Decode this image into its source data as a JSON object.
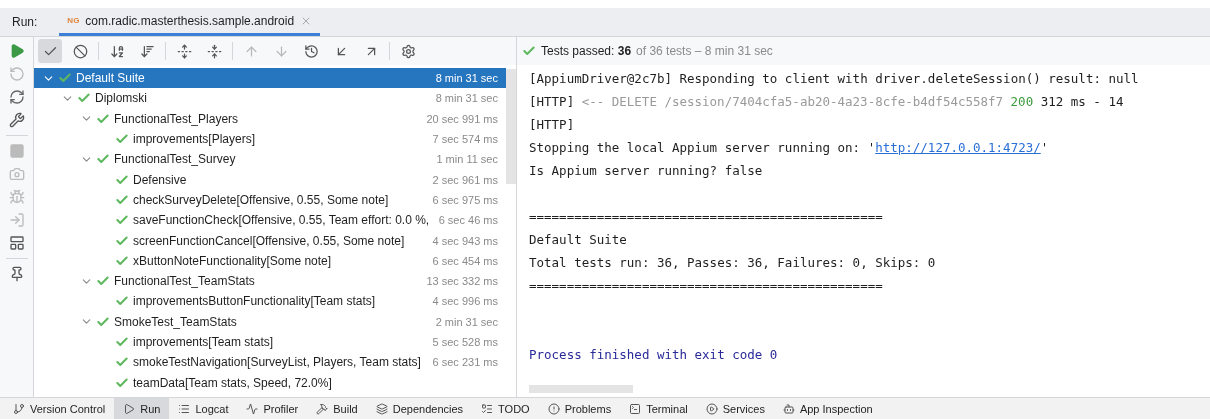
{
  "run_header": {
    "label": "Run:",
    "tab": {
      "badge": "NG",
      "title": "com.radic.masterthesis.sample.android",
      "selected": true
    }
  },
  "status": {
    "passed": "Tests passed: **36**",
    "detail": "of 36 tests – 8 min 31 sec"
  },
  "tree": [
    {
      "name": "Default Suite",
      "time": "8 min 31 sec",
      "selected": true,
      "expanded": true,
      "children": [
        {
          "name": "Diplomski",
          "time": "8 min 31 sec",
          "selected": false,
          "expanded": true,
          "children": [
            {
              "name": "FunctionalTest_Players",
              "time": "20 sec 991 ms",
              "selected": false,
              "expanded": true,
              "children": [
                {
                  "name": "improvements[Players]",
                  "time": "7 sec 574 ms",
                  "selected": false
                }
              ]
            },
            {
              "name": "FunctionalTest_Survey",
              "time": "1 min 11 sec",
              "selected": false,
              "expanded": true,
              "children": [
                {
                  "name": "Defensive",
                  "time": "2 sec 961 ms",
                  "selected": false
                },
                {
                  "name": "checkSurveyDelete[Offensive, 0.55, Some note]",
                  "time": "6 sec 975 ms",
                  "selected": false
                },
                {
                  "name": "saveFunctionCheck[Offensive, 0.55, Team effort: 0.0 %,",
                  "time": "6 sec 46 ms",
                  "selected": false
                },
                {
                  "name": "screenFunctionCancel[Offensive, 0.55, Some note]",
                  "time": "4 sec 943 ms",
                  "selected": false
                },
                {
                  "name": "xButtonNoteFunctionality[Some note]",
                  "time": "6 sec 454 ms",
                  "selected": false
                }
              ]
            },
            {
              "name": "FunctionalTest_TeamStats",
              "time": "13 sec 332 ms",
              "selected": false,
              "expanded": true,
              "children": [
                {
                  "name": "improvementsButtonFunctionality[Team stats]",
                  "time": "4 sec 996 ms",
                  "selected": false
                }
              ]
            },
            {
              "name": "SmokeTest_TeamStats",
              "time": "2 min 31 sec",
              "selected": false,
              "expanded": true,
              "children": [
                {
                  "name": "improvements[Team stats]",
                  "time": "5 sec 528 ms",
                  "selected": false
                },
                {
                  "name": "smokeTestNavigation[SurveyList, Players, Team stats]",
                  "time": "6 sec 231 ms",
                  "selected": false
                },
                {
                  "name": "teamData[Team stats, Speed, 72.0%]",
                  "selected": false
                }
              ]
            }
          ]
        }
      ]
    }
  ],
  "console": [
    {
      "kind": "text",
      "segments": [
        {
          "kind": "plain",
          "text": "[AppiumDriver@2c7b] Responding to client with driver.deleteSession() result: null"
        }
      ]
    },
    {
      "kind": "text",
      "segments": [
        {
          "kind": "plain",
          "text": "[HTTP]"
        },
        {
          "kind": "muted",
          "text": "<-- DELETE /session/7404cfa5-ab20-4a23-8cfe-b4df54c558f7"
        },
        {
          "kind": "success",
          "text": "200"
        },
        {
          "kind": "plain",
          "text": "312 ms - 14"
        }
      ]
    },
    {
      "kind": "text",
      "segments": [
        {
          "kind": "plain",
          "text": "[HTTP]"
        }
      ]
    },
    {
      "kind": "text",
      "segments": [
        {
          "kind": "plain",
          "text": "Stopping the local Appium server running on: '"
        },
        {
          "kind": "link",
          "text": "http://127.0.0.1:4723/",
          "joined": true
        },
        {
          "kind": "plain",
          "text": "'"
        }
      ]
    },
    {
      "kind": "text",
      "segments": [
        {
          "kind": "plain",
          "text": "Is Appium server running? false"
        }
      ]
    },
    {
      "kind": "blank"
    },
    {
      "kind": "text",
      "segments": [
        {
          "kind": "plain",
          "text": "==============================================="
        }
      ]
    },
    {
      "kind": "text",
      "segments": [
        {
          "kind": "plain",
          "text": "Default Suite"
        }
      ]
    },
    {
      "kind": "text",
      "segments": [
        {
          "kind": "plain",
          "text": "Total tests run: 36, Passes: 36, Failures: 0, Skips: 0"
        }
      ]
    },
    {
      "kind": "text",
      "segments": [
        {
          "kind": "plain",
          "text": "==============================================="
        }
      ]
    },
    {
      "kind": "blank"
    },
    {
      "kind": "blank"
    },
    {
      "kind": "text",
      "segments": [
        {
          "kind": "system",
          "text": "Process finished with exit code 0"
        }
      ]
    }
  ],
  "tool_tabs": [
    {
      "label": "Version Control",
      "selected": false
    },
    {
      "label": "Run",
      "selected": true
    },
    {
      "label": "Logcat",
      "selected": false
    },
    {
      "label": "Profiler",
      "selected": false
    },
    {
      "label": "Build",
      "selected": false
    },
    {
      "label": "Dependencies",
      "selected": false
    },
    {
      "label": "TODO",
      "selected": false
    },
    {
      "label": "Problems",
      "selected": false
    },
    {
      "label": "Terminal",
      "selected": false
    },
    {
      "label": "Services",
      "selected": false
    },
    {
      "label": "App Inspection",
      "selected": false
    }
  ]
}
